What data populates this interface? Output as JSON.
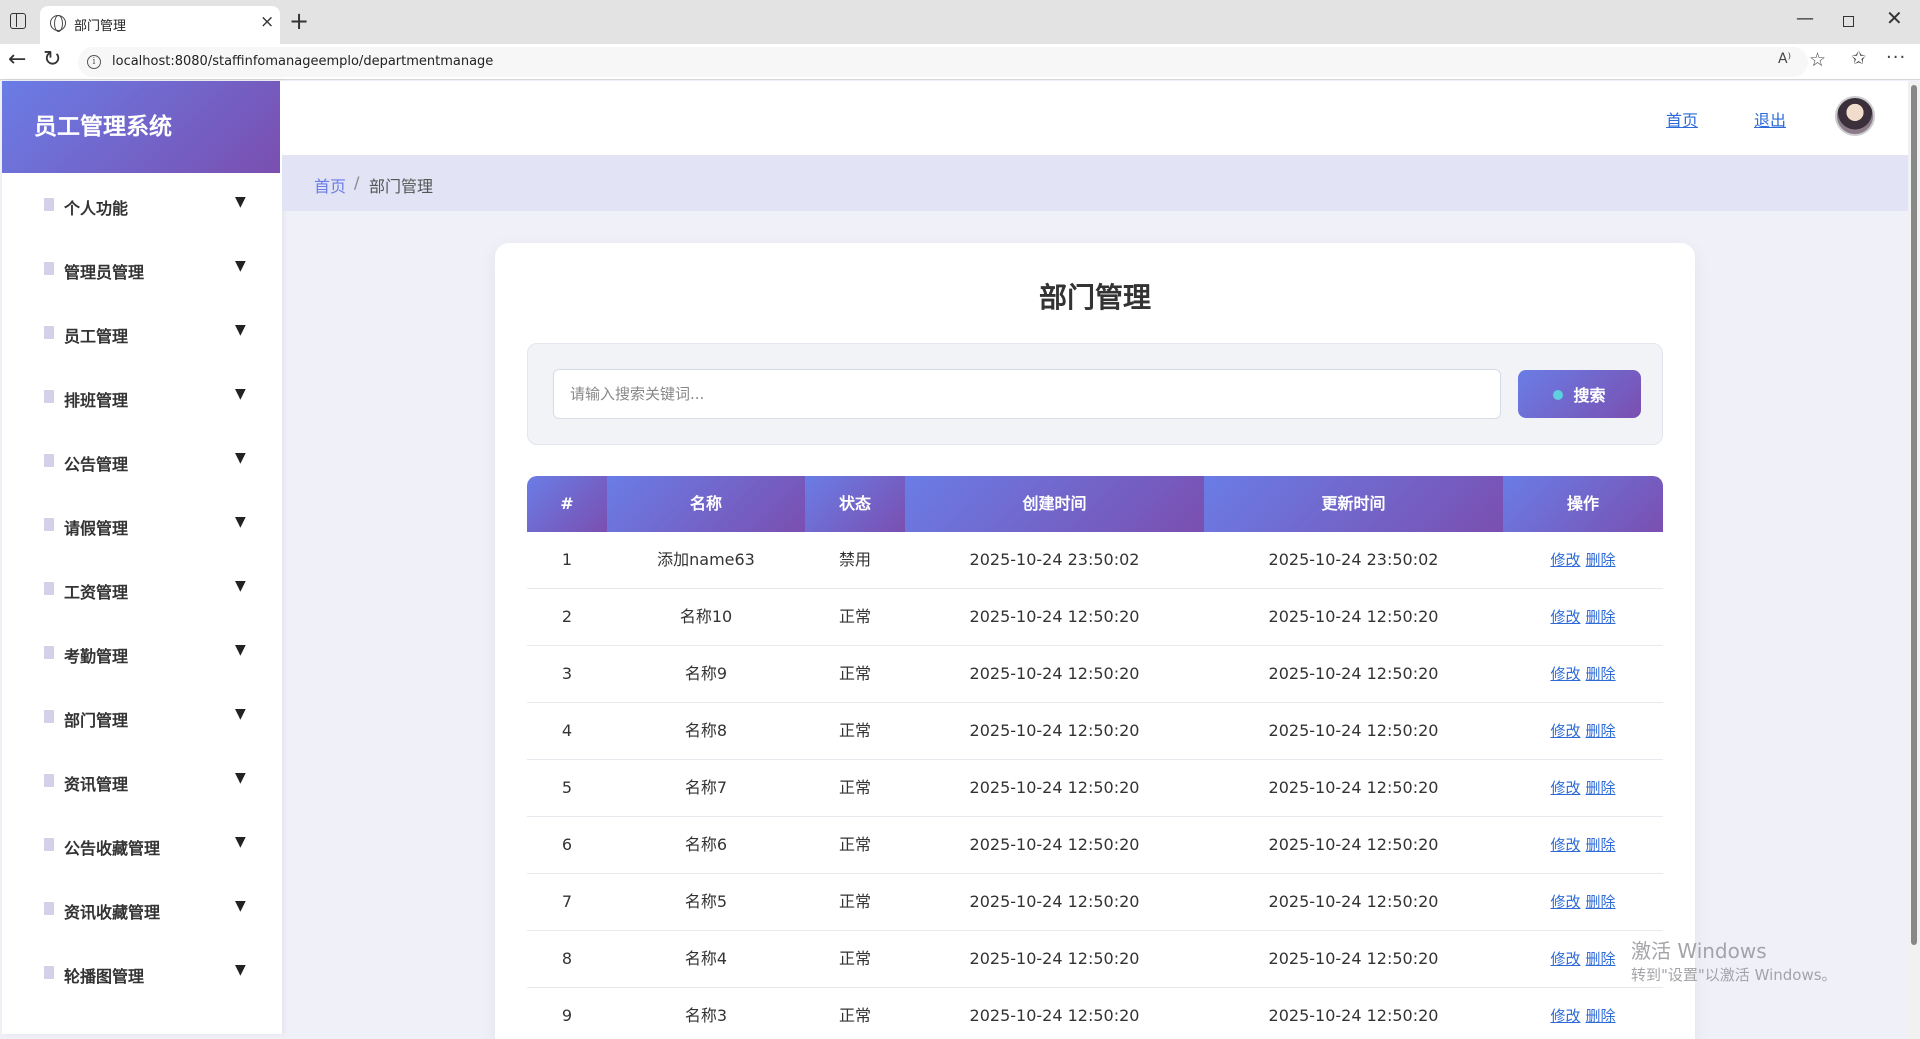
{
  "browser": {
    "tab_title": "部门管理",
    "url": "localhost:8080/staffinfomanageemplo/departmentmanage",
    "tab_close": "×",
    "newtab": "+",
    "win_min": "—",
    "win_close": "✕",
    "back": "←",
    "reload": "↻",
    "info": "i",
    "read_aloud": "A⁾",
    "fav": "☆",
    "favorites": "✩",
    "more": "···"
  },
  "sidebar": {
    "brand": "员工管理系统",
    "arrow": "▼",
    "items": [
      {
        "label": "个人功能"
      },
      {
        "label": "管理员管理"
      },
      {
        "label": "员工管理"
      },
      {
        "label": "排班管理"
      },
      {
        "label": "公告管理"
      },
      {
        "label": "请假管理"
      },
      {
        "label": "工资管理"
      },
      {
        "label": "考勤管理"
      },
      {
        "label": "部门管理"
      },
      {
        "label": "资讯管理"
      },
      {
        "label": "公告收藏管理"
      },
      {
        "label": "资讯收藏管理"
      },
      {
        "label": "轮播图管理"
      }
    ]
  },
  "topbar": {
    "home_link": "首页",
    "logout_link": "退出"
  },
  "breadcrumb": {
    "home": "首页",
    "sep": "/",
    "current": "部门管理"
  },
  "main": {
    "title": "部门管理",
    "search": {
      "placeholder": "请输入搜索关键词...",
      "button": "搜索"
    },
    "table": {
      "headers": [
        "#",
        "名称",
        "状态",
        "创建时间",
        "更新时间",
        "操作"
      ],
      "edit_label": "修改",
      "delete_label": "删除",
      "rows": [
        {
          "no": "1",
          "name": "添加name63",
          "status": "禁用",
          "created": "2025-10-24 23:50:02",
          "updated": "2025-10-24 23:50:02"
        },
        {
          "no": "2",
          "name": "名称10",
          "status": "正常",
          "created": "2025-10-24 12:50:20",
          "updated": "2025-10-24 12:50:20"
        },
        {
          "no": "3",
          "name": "名称9",
          "status": "正常",
          "created": "2025-10-24 12:50:20",
          "updated": "2025-10-24 12:50:20"
        },
        {
          "no": "4",
          "name": "名称8",
          "status": "正常",
          "created": "2025-10-24 12:50:20",
          "updated": "2025-10-24 12:50:20"
        },
        {
          "no": "5",
          "name": "名称7",
          "status": "正常",
          "created": "2025-10-24 12:50:20",
          "updated": "2025-10-24 12:50:20"
        },
        {
          "no": "6",
          "name": "名称6",
          "status": "正常",
          "created": "2025-10-24 12:50:20",
          "updated": "2025-10-24 12:50:20"
        },
        {
          "no": "7",
          "name": "名称5",
          "status": "正常",
          "created": "2025-10-24 12:50:20",
          "updated": "2025-10-24 12:50:20"
        },
        {
          "no": "8",
          "name": "名称4",
          "status": "正常",
          "created": "2025-10-24 12:50:20",
          "updated": "2025-10-24 12:50:20"
        },
        {
          "no": "9",
          "name": "名称3",
          "status": "正常",
          "created": "2025-10-24 12:50:20",
          "updated": "2025-10-24 12:50:20"
        }
      ]
    }
  },
  "watermark": {
    "line1": "激活 Windows",
    "line2": "转到\"设置\"以激活 Windows。"
  },
  "colors": {
    "accent_start": "#6a7de6",
    "accent_end": "#7a4fb0",
    "link": "#2e6bd8"
  }
}
